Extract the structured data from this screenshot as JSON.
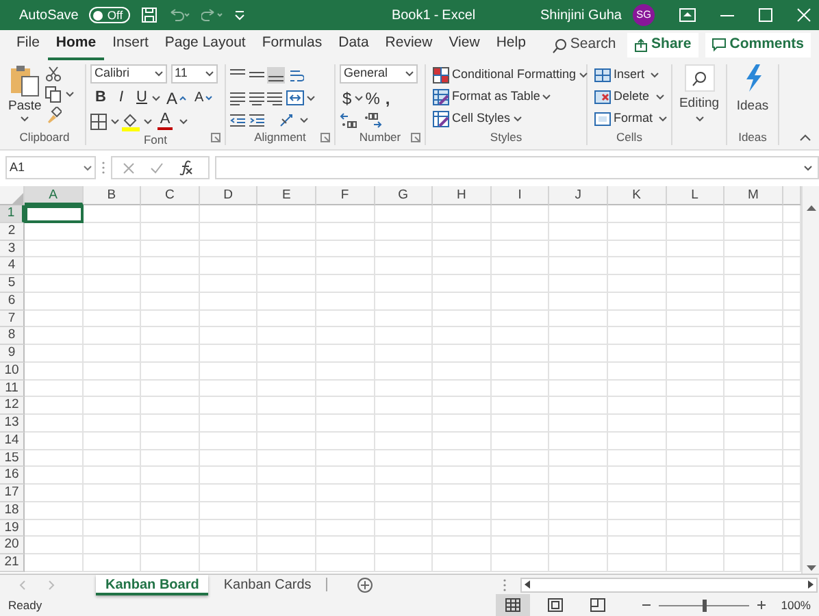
{
  "title_bar": {
    "autosave_label": "AutoSave",
    "autosave_toggle": {
      "label": "Off",
      "on": false
    },
    "document_title": "Book1",
    "separator": "-",
    "app_name": "Excel",
    "user_name": "Shinjini Guha",
    "avatar_initials": "SG"
  },
  "ribbon_tabs": [
    {
      "label": "File",
      "selected": false
    },
    {
      "label": "Home",
      "selected": true
    },
    {
      "label": "Insert",
      "selected": false
    },
    {
      "label": "Page Layout",
      "selected": false
    },
    {
      "label": "Formulas",
      "selected": false
    },
    {
      "label": "Data",
      "selected": false
    },
    {
      "label": "Review",
      "selected": false
    },
    {
      "label": "View",
      "selected": false
    },
    {
      "label": "Help",
      "selected": false
    }
  ],
  "search": {
    "placeholder": "Search"
  },
  "share_button": "Share",
  "comments_button": "Comments",
  "clipboard": {
    "paste_label": "Paste",
    "group_label": "Clipboard"
  },
  "font": {
    "font_name": "Calibri",
    "font_size": "11",
    "style_buttons": [
      "B",
      "I",
      "U"
    ],
    "size_buttons": [
      "A",
      "A"
    ],
    "font_color_label": "A",
    "group_label": "Font"
  },
  "alignment": {
    "group_label": "Alignment"
  },
  "number": {
    "format": "General",
    "symbol_buttons": [
      "$",
      "%",
      ","
    ],
    "group_label": "Number"
  },
  "styles": {
    "items": [
      "Conditional Formatting",
      "Format as Table",
      "Cell Styles"
    ],
    "group_label": "Styles"
  },
  "cells": {
    "items": [
      "Insert",
      "Delete",
      "Format"
    ],
    "group_label": "Cells"
  },
  "editing": {
    "label": "Editing"
  },
  "ideas": {
    "label": "Ideas",
    "group_label": "Ideas"
  },
  "formula_bar": {
    "name_box": "A1"
  },
  "columns": [
    {
      "label": "A",
      "selected": true
    },
    {
      "label": "B",
      "selected": false
    },
    {
      "label": "C",
      "selected": false
    },
    {
      "label": "D",
      "selected": false
    },
    {
      "label": "E",
      "selected": false
    },
    {
      "label": "F",
      "selected": false
    },
    {
      "label": "G",
      "selected": false
    },
    {
      "label": "H",
      "selected": false
    },
    {
      "label": "I",
      "selected": false
    },
    {
      "label": "J",
      "selected": false
    },
    {
      "label": "K",
      "selected": false
    },
    {
      "label": "L",
      "selected": false
    },
    {
      "label": "M",
      "selected": false
    }
  ],
  "rows": [
    {
      "label": "1",
      "selected": true
    },
    {
      "label": "2",
      "selected": false
    },
    {
      "label": "3",
      "selected": false
    },
    {
      "label": "4",
      "selected": false
    },
    {
      "label": "5",
      "selected": false
    },
    {
      "label": "6",
      "selected": false
    },
    {
      "label": "7",
      "selected": false
    },
    {
      "label": "8",
      "selected": false
    },
    {
      "label": "9",
      "selected": false
    },
    {
      "label": "10",
      "selected": false
    },
    {
      "label": "11",
      "selected": false
    },
    {
      "label": "12",
      "selected": false
    },
    {
      "label": "13",
      "selected": false
    },
    {
      "label": "14",
      "selected": false
    },
    {
      "label": "15",
      "selected": false
    },
    {
      "label": "16",
      "selected": false
    },
    {
      "label": "17",
      "selected": false
    },
    {
      "label": "18",
      "selected": false
    },
    {
      "label": "19",
      "selected": false
    },
    {
      "label": "20",
      "selected": false
    },
    {
      "label": "21",
      "selected": false
    }
  ],
  "sheet_tabs": [
    {
      "label": "Kanban Board",
      "selected": true
    },
    {
      "label": "Kanban Cards",
      "selected": false
    }
  ],
  "status_bar": {
    "status": "Ready",
    "zoom": {
      "level": 0.5,
      "reading": "100%"
    }
  }
}
